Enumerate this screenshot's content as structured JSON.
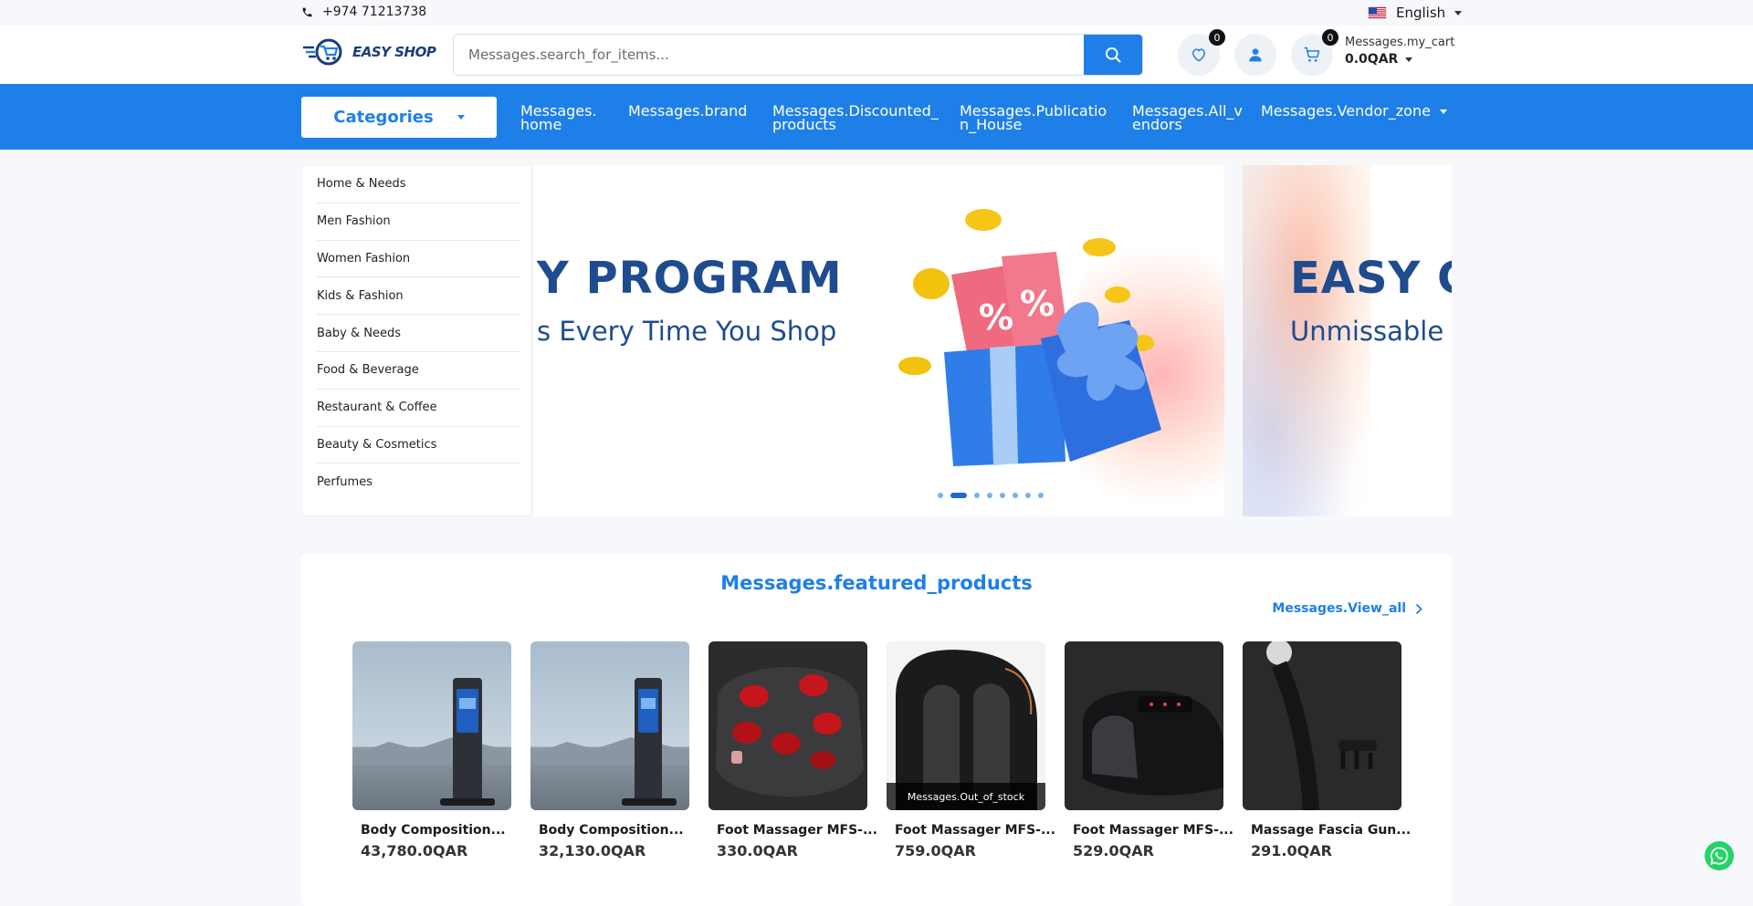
{
  "topbar": {
    "phone": "+974 71213738",
    "language": "English"
  },
  "header": {
    "logo_text": "EASY SHOP",
    "search_placeholder": "Messages.search_for_items...",
    "wishlist_count": "0",
    "cart_count": "0",
    "cart_label": "Messages.my_cart",
    "cart_total": "0.0QAR"
  },
  "nav": {
    "categories_label": "Categories",
    "items": [
      {
        "label": "Messages.\nhome"
      },
      {
        "label": "Messages.brand"
      },
      {
        "label": "Messages.Discounted_\nproducts"
      },
      {
        "label": "Messages.Publicatio\nn_House"
      },
      {
        "label": "Messages.All_v\nendors"
      },
      {
        "label": "Messages.Vendor_zone"
      }
    ]
  },
  "sidebar": {
    "categories": [
      "Home & Needs",
      "Men Fashion",
      "Women Fashion",
      "Kids & Fashion",
      "Baby & Needs",
      "Food & Beverage",
      "Restaurant & Coffee",
      "Beauty & Cosmetics",
      "Perfumes"
    ]
  },
  "banner": {
    "heading": "Y PROGRAM",
    "subheading": "s Every Time You Shop",
    "heading2": "EASY C",
    "subheading2": "Unmissable",
    "slide_count": 8,
    "active_slide": 2
  },
  "featured": {
    "title": "Messages.featured_products",
    "view_all": "Messages.View_all",
    "out_of_stock_label": "Messages.Out_of_stock",
    "products": [
      {
        "name": "Body Composition...",
        "price": "43,780.0QAR",
        "image": "kiosk-scale",
        "out_of_stock": false
      },
      {
        "name": "Body Composition...",
        "price": "32,130.0QAR",
        "image": "kiosk-scale",
        "out_of_stock": false
      },
      {
        "name": "Foot Massager MFS-...",
        "price": "330.0QAR",
        "image": "foot-massager-red",
        "out_of_stock": false
      },
      {
        "name": "Foot Massager MFS-...",
        "price": "759.0QAR",
        "image": "foot-massager-tall",
        "out_of_stock": true
      },
      {
        "name": "Foot Massager MFS-...",
        "price": "529.0QAR",
        "image": "foot-massager-flat",
        "out_of_stock": false
      },
      {
        "name": "Massage Fascia Gun...",
        "price": "291.0QAR",
        "image": "fascia-gun",
        "out_of_stock": false
      }
    ]
  },
  "colors": {
    "primary": "#1e7fe8",
    "navy": "#1f4b8f",
    "whatsapp": "#25d366"
  }
}
